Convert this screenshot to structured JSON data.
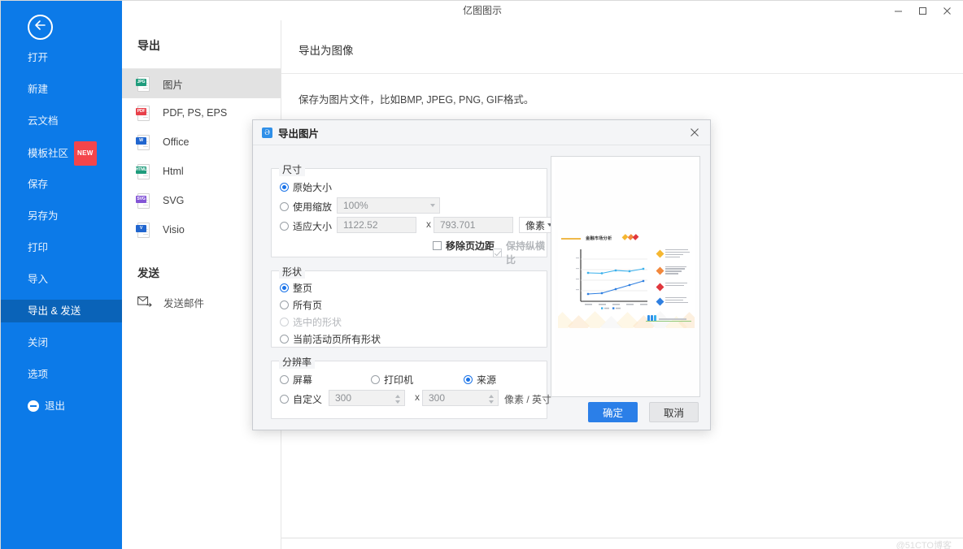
{
  "window": {
    "title": "亿图图示",
    "minimize": "–",
    "maximize": "□",
    "close": "✕"
  },
  "sidebar": {
    "back_icon": "back-arrow-icon",
    "items": [
      {
        "label": "打开",
        "active": false,
        "badge": ""
      },
      {
        "label": "新建",
        "active": false,
        "badge": ""
      },
      {
        "label": "云文档",
        "active": false,
        "badge": ""
      },
      {
        "label": "模板社区",
        "active": false,
        "badge": "NEW"
      },
      {
        "label": "保存",
        "active": false,
        "badge": ""
      },
      {
        "label": "另存为",
        "active": false,
        "badge": ""
      },
      {
        "label": "打印",
        "active": false,
        "badge": ""
      },
      {
        "label": "导入",
        "active": false,
        "badge": ""
      },
      {
        "label": "导出 & 发送",
        "active": true,
        "badge": ""
      },
      {
        "label": "关闭",
        "active": false,
        "badge": ""
      },
      {
        "label": "选项",
        "active": false,
        "badge": ""
      },
      {
        "label": "退出",
        "active": false,
        "badge": ""
      }
    ],
    "bg_color": "#0c7ae8",
    "active_color": "#0a63b8"
  },
  "export_panel": {
    "title": "导出",
    "formats": [
      {
        "label": "图片",
        "tag": "JPG",
        "color": "#1f9c7c",
        "selected": true
      },
      {
        "label": "PDF, PS, EPS",
        "tag": "PDF",
        "color": "#e8404a",
        "selected": false
      },
      {
        "label": "Office",
        "tag": "W",
        "color": "#2166cf",
        "selected": false
      },
      {
        "label": "Html",
        "tag": "HTML",
        "color": "#1f9c7c",
        "selected": false
      },
      {
        "label": "SVG",
        "tag": "SVG",
        "color": "#8355d6",
        "selected": false
      },
      {
        "label": "Visio",
        "tag": "V",
        "color": "#2166cf",
        "selected": false
      }
    ],
    "send_title": "发送",
    "send_item": "发送邮件",
    "send_icon": "mail-send-icon"
  },
  "main": {
    "title": "导出为图像",
    "description": "保存为图片文件，比如BMP, JPEG, PNG, GIF格式。",
    "card_tag": "JPG",
    "watermark": "@51CTO博客"
  },
  "dialog": {
    "title": "导出图片",
    "logo_glyph": "Ə",
    "close_icon": "close-icon",
    "size": {
      "legend": "尺寸",
      "original_label": "原始大小",
      "original_selected": true,
      "scale_label": "使用缩放",
      "scale_selected": false,
      "scale_value": "100%",
      "fit_label": "适应大小",
      "fit_selected": false,
      "width_value": "1122.52",
      "height_value": "793.701",
      "x_separator": "x",
      "unit_value": "像素",
      "remove_margin_label": "移除页边距",
      "remove_margin_checked": false,
      "keep_ratio_label": "保持纵横比",
      "keep_ratio_checked": true,
      "keep_ratio_disabled": true
    },
    "shape": {
      "legend": "形状",
      "options": [
        {
          "label": "整页",
          "selected": true,
          "disabled": false
        },
        {
          "label": "所有页",
          "selected": false,
          "disabled": false
        },
        {
          "label": "选中的形状",
          "selected": false,
          "disabled": true
        },
        {
          "label": "当前活动页所有形状",
          "selected": false,
          "disabled": false
        }
      ]
    },
    "resolution": {
      "legend": "分辨率",
      "options": [
        {
          "label": "屏幕",
          "selected": false
        },
        {
          "label": "打印机",
          "selected": false
        },
        {
          "label": "来源",
          "selected": true
        }
      ],
      "custom_label": "自定义",
      "custom_selected": false,
      "dpi_x": "300",
      "dpi_y": "300",
      "x_separator": "x",
      "unit": "像素 / 英寸"
    },
    "preview": {
      "chart_title": "金融市场分析",
      "legend_count": 4,
      "legend_colors": [
        "#f5b731",
        "#f2883c",
        "#e0373d",
        "#2f7fe0"
      ]
    },
    "ok_label": "确定",
    "cancel_label": "取消"
  },
  "chart_data": {
    "type": "line",
    "title": "金融市场分析",
    "categories": [
      "2015",
      "2016",
      "2017",
      "2018",
      "2019"
    ],
    "series": [
      {
        "name": "上线",
        "values": [
          62,
          63,
          67,
          67,
          71
        ],
        "color": "#39b0ec"
      },
      {
        "name": "下线",
        "values": [
          28,
          30,
          38,
          46,
          54
        ],
        "color": "#2f7fe0"
      }
    ],
    "xlabel": "",
    "ylabel": "",
    "ylim": [
      0,
      100
    ],
    "grid": true,
    "legend": "bottom"
  }
}
